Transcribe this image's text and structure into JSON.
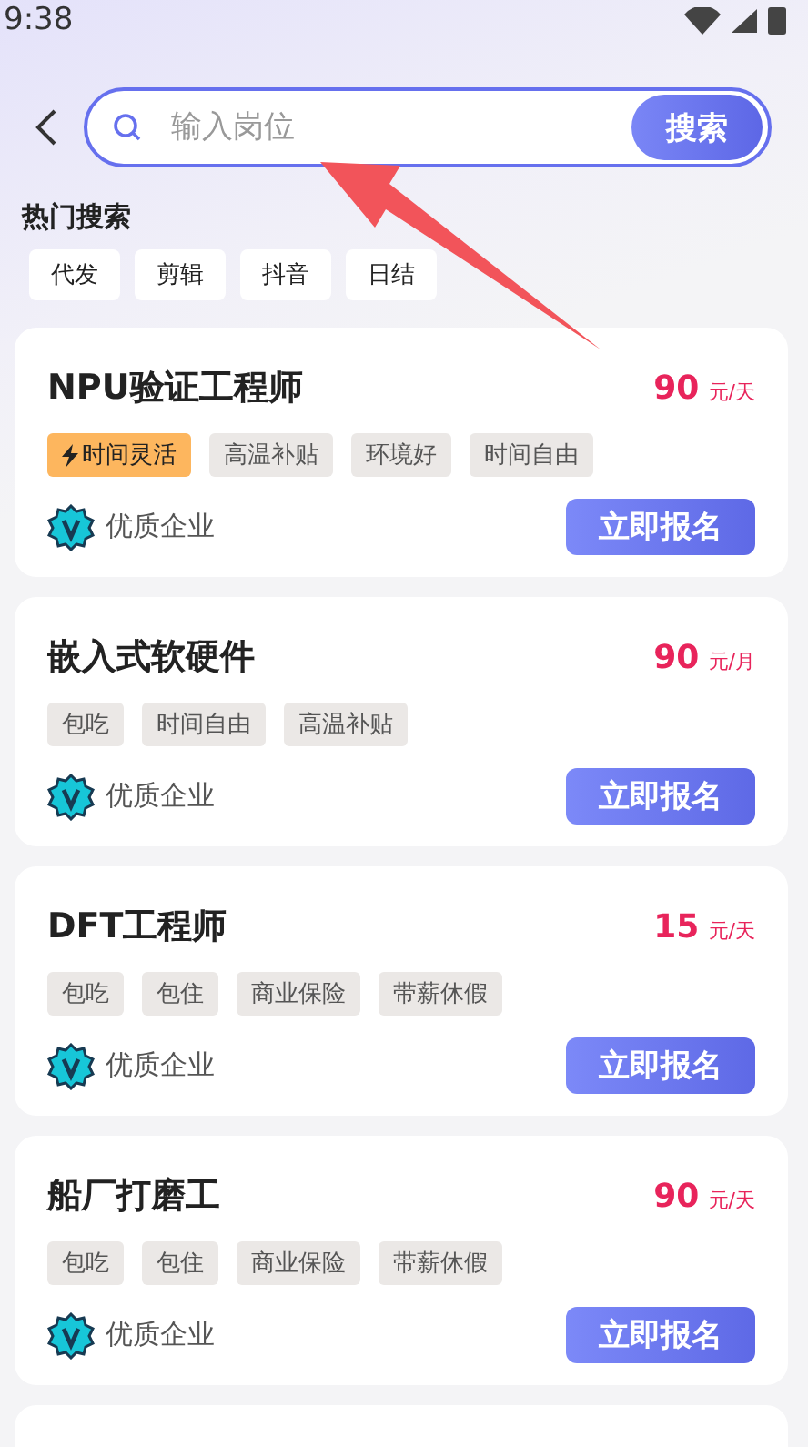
{
  "status_bar": {
    "time": "9:38"
  },
  "search": {
    "placeholder": "输入岗位",
    "button": "搜索"
  },
  "hot_search": {
    "title": "热门搜索",
    "tags": [
      "代发",
      "剪辑",
      "抖音",
      "日结"
    ]
  },
  "jobs": [
    {
      "title": "NPU验证工程师",
      "salary": "90",
      "unit": "元/天",
      "tags": [
        {
          "label": "时间灵活",
          "kind": "highlight"
        },
        {
          "label": "高温补贴",
          "kind": "plain"
        },
        {
          "label": "环境好",
          "kind": "plain"
        },
        {
          "label": "时间自由",
          "kind": "plain"
        }
      ],
      "company": "优质企业",
      "action": "立即报名"
    },
    {
      "title": "嵌入式软硬件",
      "salary": "90",
      "unit": "元/月",
      "tags": [
        {
          "label": "包吃",
          "kind": "plain"
        },
        {
          "label": "时间自由",
          "kind": "plain"
        },
        {
          "label": "高温补贴",
          "kind": "plain"
        }
      ],
      "company": "优质企业",
      "action": "立即报名"
    },
    {
      "title": "DFT工程师",
      "salary": "15",
      "unit": "元/天",
      "tags": [
        {
          "label": "包吃",
          "kind": "plain"
        },
        {
          "label": "包住",
          "kind": "plain"
        },
        {
          "label": "商业保险",
          "kind": "plain"
        },
        {
          "label": "带薪休假",
          "kind": "plain"
        }
      ],
      "company": "优质企业",
      "action": "立即报名"
    },
    {
      "title": "船厂打磨工",
      "salary": "90",
      "unit": "元/天",
      "tags": [
        {
          "label": "包吃",
          "kind": "plain"
        },
        {
          "label": "包住",
          "kind": "plain"
        },
        {
          "label": "商业保险",
          "kind": "plain"
        },
        {
          "label": "带薪休假",
          "kind": "plain"
        }
      ],
      "company": "优质企业",
      "action": "立即报名"
    }
  ]
}
